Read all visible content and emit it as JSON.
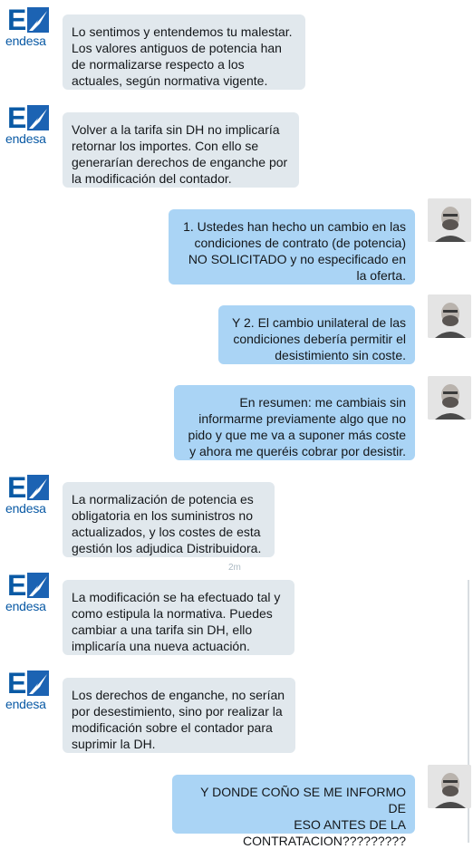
{
  "brand": {
    "logo_word": "endesa",
    "logo_letter": "E",
    "color": "#0a5aa5"
  },
  "messages": [
    {
      "id": 1,
      "from": "endesa",
      "text": "Lo sentimos y entendemos tu malestar.\nLos valores antiguos de potencia han\nde normalizarse respecto a los\nactuales, según normativa vigente."
    },
    {
      "id": 2,
      "from": "endesa",
      "text": "Volver a la tarifa sin DH no implicaría\nretornar los importes. Con ello se\ngenerarían derechos de enganche por\nla modificación del contador."
    },
    {
      "id": 3,
      "from": "user",
      "text": "1. Ustedes han hecho un cambio en las\ncondiciones de contrato (de potencia)\nNO SOLICITADO y no especificado en\nla oferta."
    },
    {
      "id": 4,
      "from": "user",
      "text": "Y 2. El cambio unilateral de las\ncondiciones debería permitir el\ndesistimiento sin coste."
    },
    {
      "id": 5,
      "from": "user",
      "text": "En resumen: me cambiais sin\ninformarme previamente algo que no\npido y que me va a suponer más coste\ny ahora me queréis cobrar por desistir."
    },
    {
      "id": 6,
      "from": "endesa",
      "text": "La normalización de potencia es\nobligatoria en los suministros no\nactualizados, y los costes de esta\ngestión los adjudica Distribuidora."
    },
    {
      "id": 7,
      "from": "endesa",
      "text": "La modificación se ha efectuado tal y\ncomo estipula la normativa. Puedes\ncambiar a una tarifa sin DH, ello\nimplicaría una nueva actuación."
    },
    {
      "id": 8,
      "from": "endesa",
      "text": "Los derechos de enganche, no serían\npor desestimiento, sino por realizar la\nmodificación sobre el contador para\nsuprimir la DH."
    },
    {
      "id": 9,
      "from": "user",
      "text": "Y DONDE COÑO SE ME INFORMO DE\nESO ANTES DE LA\nCONTRATACION?????????"
    }
  ],
  "timestamp": "2m",
  "colors": {
    "incoming_bubble": "#e1e8ed",
    "outgoing_bubble": "#aad4f5"
  }
}
